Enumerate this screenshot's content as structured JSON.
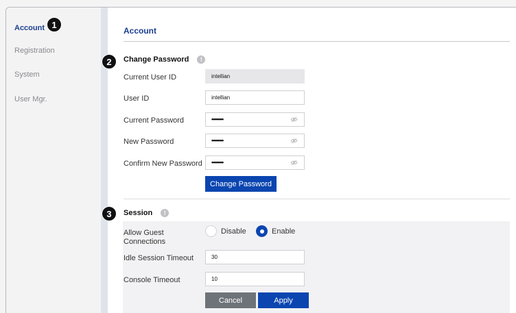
{
  "sidebar": {
    "items": [
      {
        "label": "Account"
      },
      {
        "label": "Registration"
      },
      {
        "label": "System"
      },
      {
        "label": "User Mgr."
      }
    ]
  },
  "callouts": [
    "1",
    "2",
    "3"
  ],
  "page_title": "Account",
  "change_password": {
    "title": "Change Password",
    "current_user_id": {
      "label": "Current User ID",
      "value": "intellian"
    },
    "user_id": {
      "label": "User ID",
      "value": "intellian"
    },
    "current_password": {
      "label": "Current Password",
      "value": "••••••••"
    },
    "new_password": {
      "label": "New Password",
      "value": "••••••••"
    },
    "confirm_password": {
      "label": "Confirm New Password",
      "value": "••••••••"
    },
    "button": "Change Password"
  },
  "session": {
    "title": "Session",
    "guest": {
      "label": "Allow Guest Connections",
      "options": [
        "Disable",
        "Enable"
      ],
      "selected": "Enable"
    },
    "idle_timeout": {
      "label": "Idle Session Timeout",
      "value": "30"
    },
    "console_timeout": {
      "label": "Console Timeout",
      "value": "10"
    },
    "cancel": "Cancel",
    "apply": "Apply"
  },
  "colors": {
    "accent": "#0a45b0",
    "title": "#1b3f8f",
    "cancel": "#6e737a"
  },
  "icons": {
    "info": "info-icon",
    "eye": "eye-hidden-icon"
  }
}
